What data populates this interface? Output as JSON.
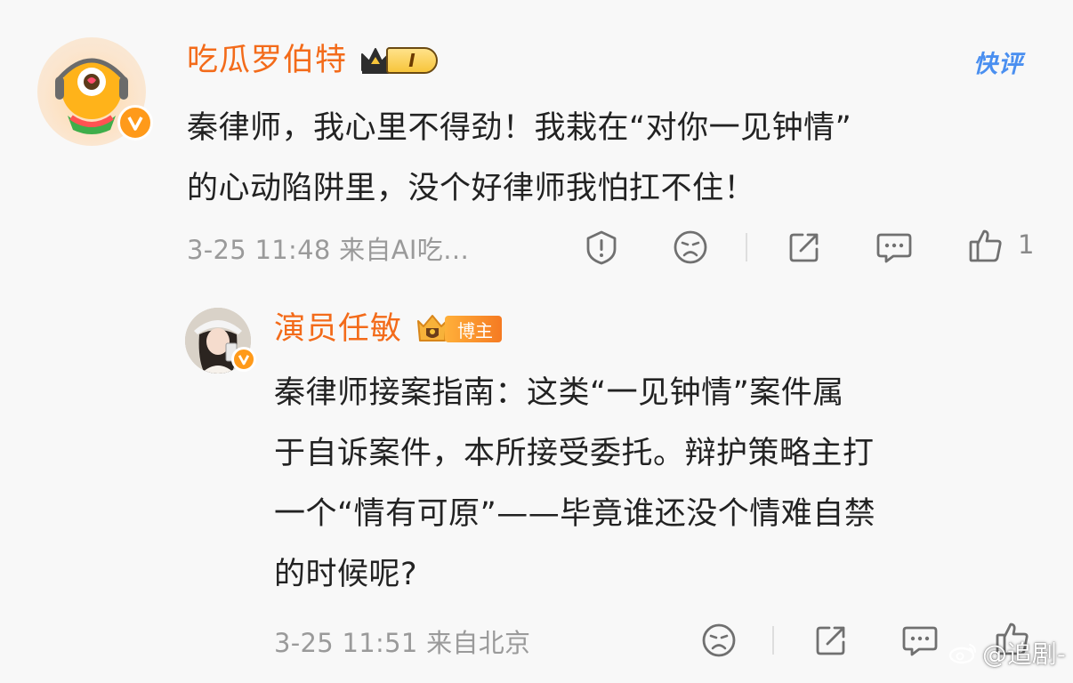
{
  "top_comment": {
    "username": "吃瓜罗伯特",
    "level": "I",
    "quick_review": "快评",
    "text_lines": [
      "秦律师，我心里不得劲！我栽在“对你一见钟情”",
      "的心动陷阱里，没个好律师我怕扛不住！"
    ],
    "meta": "3-25 11:48 来自AI吃…",
    "like_count": "1",
    "icons": [
      "report-icon",
      "dislike-icon",
      "share-icon",
      "comment-icon",
      "like-icon"
    ]
  },
  "reply": {
    "username": "演员任敏",
    "badge_label": "博主",
    "text_lines": [
      "秦律师接案指南：这类“一见钟情”案件属",
      "于自诉案件，本所接受委托。辩护策略主打",
      "一个“情有可原”——毕竟谁还没个情难自禁",
      "的时候呢?"
    ],
    "meta": "3-25 11:51 来自北京",
    "icons": [
      "dislike-icon",
      "share-icon",
      "comment-icon",
      "like-icon"
    ]
  },
  "watermark": "@追剧-",
  "colors": {
    "username": "#f36b1a",
    "meta": "#9a9a9a",
    "quick_review": "#4a8ff0",
    "verified": "#ff9a1a"
  }
}
